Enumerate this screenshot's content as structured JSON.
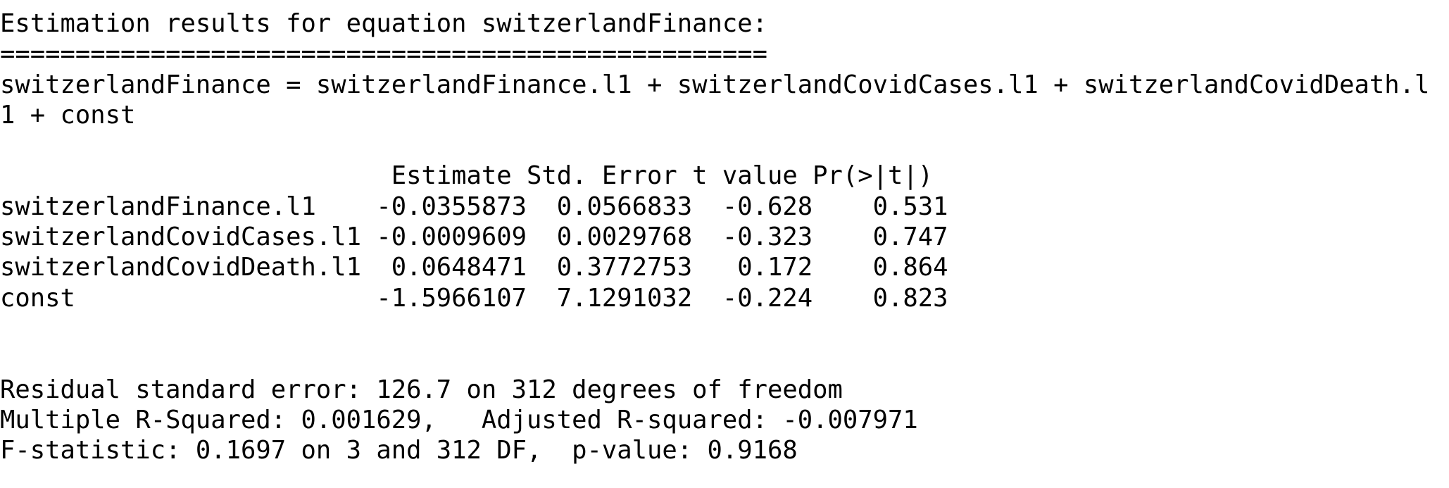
{
  "output": {
    "heading": "Estimation results for equation switzerlandFinance:",
    "rule": "===================================================",
    "formula_line_1": "switzerlandFinance = switzerlandFinance.l1 + switzerlandCovidCases.l1 + switzerlandCovidDeath.l",
    "formula_line_2": "1 + const",
    "coef_header": "                          Estimate Std. Error t value Pr(>|t|)",
    "coef_rows": [
      "switzerlandFinance.l1    -0.0355873  0.0566833  -0.628    0.531",
      "switzerlandCovidCases.l1 -0.0009609  0.0029768  -0.323    0.747",
      "switzerlandCovidDeath.l1  0.0648471  0.3772753   0.172    0.864",
      "const                    -1.5966107  7.1291032  -0.224    0.823"
    ],
    "residual_se": "Residual standard error: 126.7 on 312 degrees of freedom",
    "r_squared": "Multiple R-Squared: 0.001629,   Adjusted R-squared: -0.007971",
    "f_statistic": "F-statistic: 0.1697 on 3 and 312 DF,  p-value: 0.9168"
  }
}
